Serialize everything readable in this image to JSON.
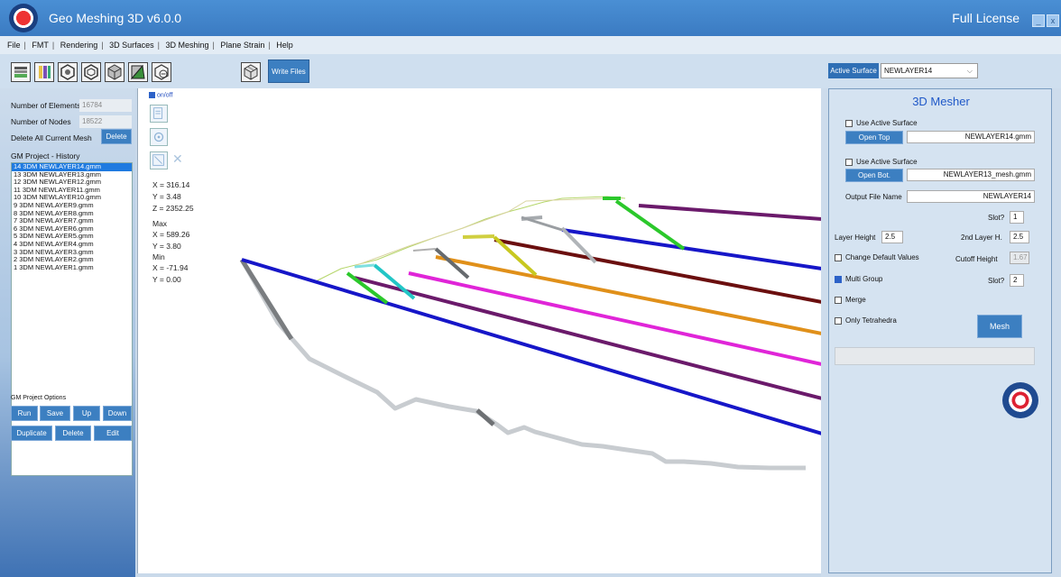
{
  "app": {
    "title": "Geo Meshing 3D v6.0.0",
    "license": "Full License",
    "minimize": "_",
    "close": "x"
  },
  "menu": {
    "items": [
      "File",
      "FMT",
      "Rendering",
      "3D Surfaces",
      "3D Meshing",
      "Plane Strain",
      "Help"
    ],
    "sep": "|"
  },
  "toolbar": {
    "icons": [
      "layers-icon",
      "columns-icon",
      "hexagon-icon",
      "hexagon-outline-icon",
      "cube-icon",
      "triangle-icon",
      "hexagon-minus-icon"
    ],
    "write_files": "Write Files",
    "active_surface_label": "Active Surface",
    "active_surface_value": "NEWLAYER14",
    "chevron": "⌵"
  },
  "left": {
    "num_elements_label": "Number of Elements",
    "num_elements": "16784",
    "num_nodes_label": "Number of Nodes",
    "num_nodes": "18522",
    "delete_mesh_label": "Delete All Current Mesh",
    "delete_button": "Delete",
    "history_title": "GM Project - History",
    "history": [
      "14 3DM NEWLAYER14.gmm",
      "13 3DM NEWLAYER13.gmm",
      "12 3DM NEWLAYER12.gmm",
      "11 3DM NEWLAYER11.gmm",
      "10 3DM NEWLAYER10.gmm",
      "9 3DM NEWLAYER9.gmm",
      "8 3DM NEWLAYER8.gmm",
      "7 3DM NEWLAYER7.gmm",
      "6 3DM NEWLAYER6.gmm",
      "5 3DM NEWLAYER5.gmm",
      "4 3DM NEWLAYER4.gmm",
      "3 3DM NEWLAYER3.gmm",
      "2 3DM NEWLAYER2.gmm",
      "1 3DM NEWLAYER1.gmm"
    ],
    "options_title": "GM Project Options",
    "buttons": {
      "run": "Run",
      "save": "Save",
      "up": "Up",
      "down": "Down",
      "duplicate": "Duplicate",
      "delete": "Delete",
      "edit": "Edit"
    }
  },
  "viewport": {
    "onoff": "on/off",
    "x": "X =  316.14",
    "y": "Y =  3.48",
    "z": "Z =  2352.25",
    "max_label": "Max",
    "max_x": "X =  589.26",
    "max_y": "Y =  3.80",
    "min_label": "Min",
    "min_x": "X =  -71.94",
    "min_y": "Y =  0.00",
    "close_glyph": "✕"
  },
  "mesher": {
    "title": "3D Mesher",
    "use_active_top": "Use Active Surface",
    "open_top": "Open Top",
    "top_file": "NEWLAYER14.gmm",
    "use_active_bot": "Use Active Surface",
    "open_bot": "Open Bot.",
    "bot_file": "NEWLAYER13_mesh.gmm",
    "output_label": "Output File Name",
    "output_value": "NEWLAYER14",
    "slot_label": "Slot?",
    "slot_value": "1",
    "layer_height_label": "Layer Height",
    "layer_height": "2.5",
    "layer2_label": "2nd Layer H.",
    "layer2": "2.5",
    "change_defaults": "Change Default Values",
    "cutoff_label": "Cutoff Height",
    "cutoff": "1.67",
    "multi_group": "Multi Group",
    "slot2_label": "Slot?",
    "slot2_value": "2",
    "merge": "Merge",
    "only_tetra": "Only Tetrahedra",
    "mesh_button": "Mesh"
  },
  "colors": {
    "accent": "#3c7fc1",
    "titlebar": "#3b7bc2"
  }
}
